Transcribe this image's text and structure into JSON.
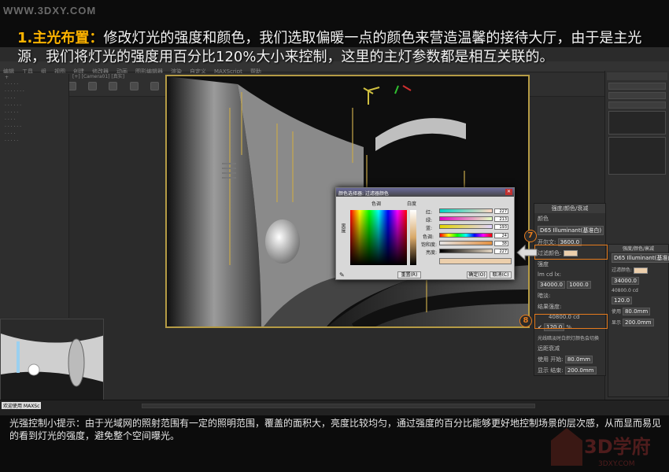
{
  "watermark": "WWW.3DXY.COM",
  "headline": {
    "title": "1.主光布置：",
    "body": "修改灯光的强度和颜色，我们选取偏暖一点的颜色来营造温馨的接待大厅，由于是主光源，我们将灯光的强度用百分比120%大小来控制，这里的主灯参数都是相互关联的。"
  },
  "viewport_label": "[+] [Camera01] [真实]",
  "color_dialog": {
    "title": "颜色选择器: 过滤器颜色",
    "hue_label": "色调",
    "whiteness_label": "白度",
    "blackness_label": "黑度",
    "channels": [
      {
        "label": "红:",
        "value": "227"
      },
      {
        "label": "绿:",
        "value": "213"
      },
      {
        "label": "蓝:",
        "value": "193"
      },
      {
        "label": "色调:",
        "value": "24"
      },
      {
        "label": "饱和度:",
        "value": "38"
      },
      {
        "label": "亮度:",
        "value": "227"
      }
    ],
    "reset_label": "重置(R)",
    "ok_label": "确定(O)",
    "cancel_label": "取消(C)",
    "current_color": "#e3d5c1"
  },
  "intensity_panel": {
    "title": "强度/颜色/衰减",
    "color_section": "颜色",
    "illuminant": "D65 Illuminant(基准白)",
    "kelvin_label": "开尔文:",
    "kelvin_value": "3600.0",
    "filter_color_label": "过滤颜色:",
    "intensity_label": "强度",
    "units": [
      "lm",
      "cd",
      "lx:"
    ],
    "intensity_value": "34000.0",
    "distance_value": "1000.0",
    "dimming_label": "暗淡:",
    "result_label": "结果强度:",
    "result_value": "40800.0 cd",
    "percent_value": "120.0",
    "percent_unit": "%",
    "incandescent_label": "光线暗淡时白炽灯颜色会切换",
    "far_atten_label": "远距衰减",
    "use_label": "使用",
    "show_label": "显示",
    "start_label": "开始:",
    "start_value": "80.0mm",
    "end_label": "结束:",
    "end_value": "200.0mm"
  },
  "markers": {
    "seven": "⑦",
    "eight": "⑧"
  },
  "status_badge": "欢迎使用 MAXSc",
  "tip": "光强控制小提示：由于光域网的照射范围有一定的照明范围，覆盖的面积大，亮度比较均匀，通过强度的百分比能够更好地控制场景的层次感，从而显而易见的看到灯光的强度，避免整个空间曝光。",
  "logo_text": "3D学府",
  "logo_url": "3DXY.COM"
}
